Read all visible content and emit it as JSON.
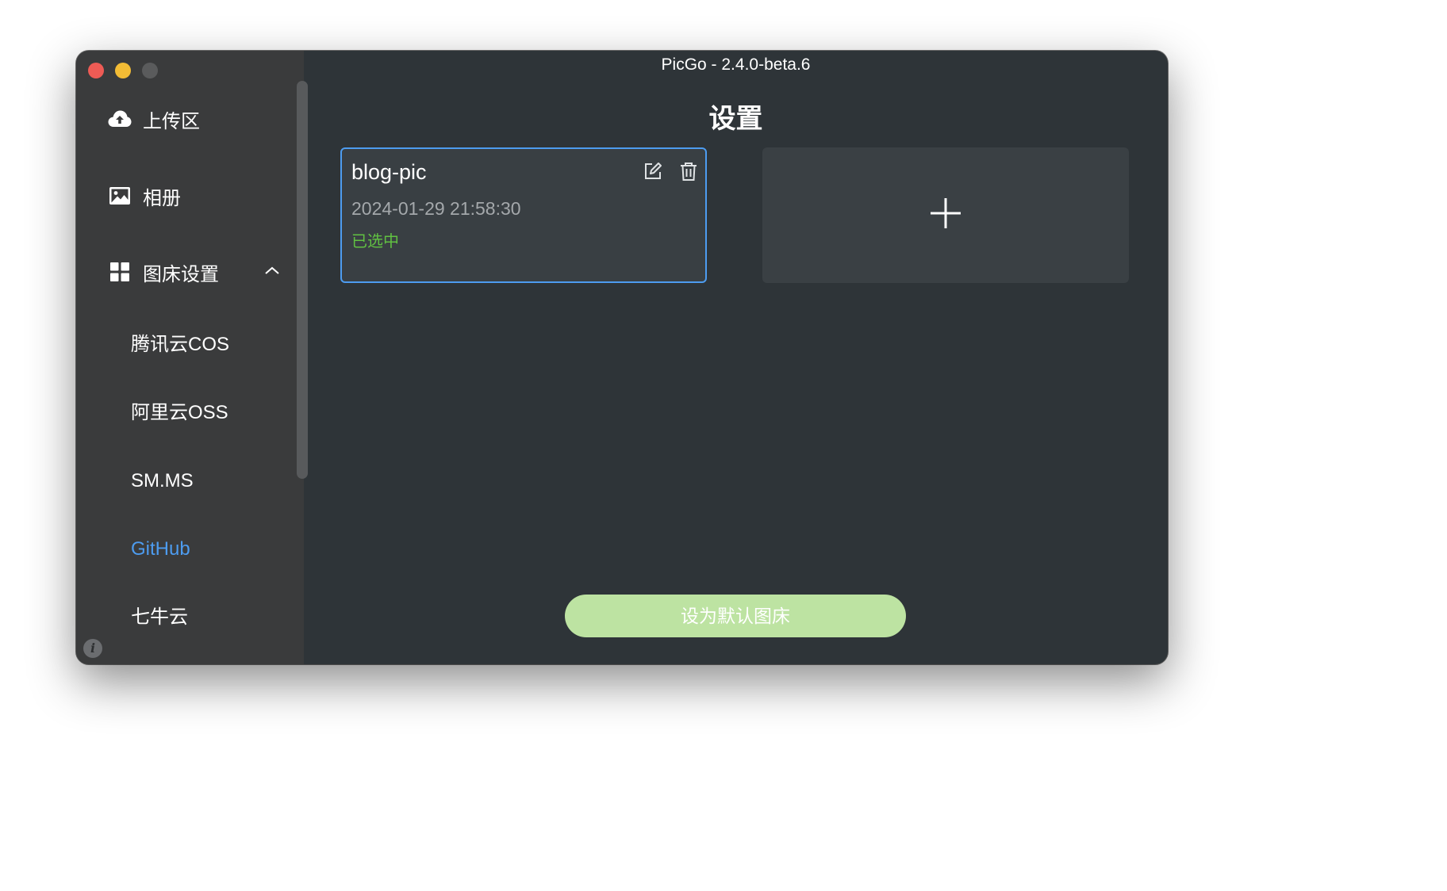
{
  "window": {
    "title": "PicGo - 2.4.0-beta.6"
  },
  "sidebar": {
    "items": [
      {
        "label": "上传区",
        "icon": "cloud-upload-icon"
      },
      {
        "label": "相册",
        "icon": "image-icon"
      },
      {
        "label": "图床设置",
        "icon": "grid-icon",
        "expanded": true
      }
    ],
    "sub_items": [
      {
        "label": "腾讯云COS",
        "active": false
      },
      {
        "label": "阿里云OSS",
        "active": false
      },
      {
        "label": "SM.MS",
        "active": false
      },
      {
        "label": "GitHub",
        "active": true
      },
      {
        "label": "七牛云",
        "active": false
      }
    ],
    "info_glyph": "i"
  },
  "main": {
    "title": "设置",
    "config_card": {
      "name": "blog-pic",
      "time": "2024-01-29 21:58:30",
      "status": "已选中"
    },
    "add_card_icon": "plus-icon",
    "default_button": "设为默认图床"
  },
  "colors": {
    "accent_blue": "#4d9cf0",
    "selected_green": "#61c142",
    "button_green": "#bde3a2",
    "sidebar_bg": "#3a3b3c",
    "main_bg": "#2e3438"
  }
}
